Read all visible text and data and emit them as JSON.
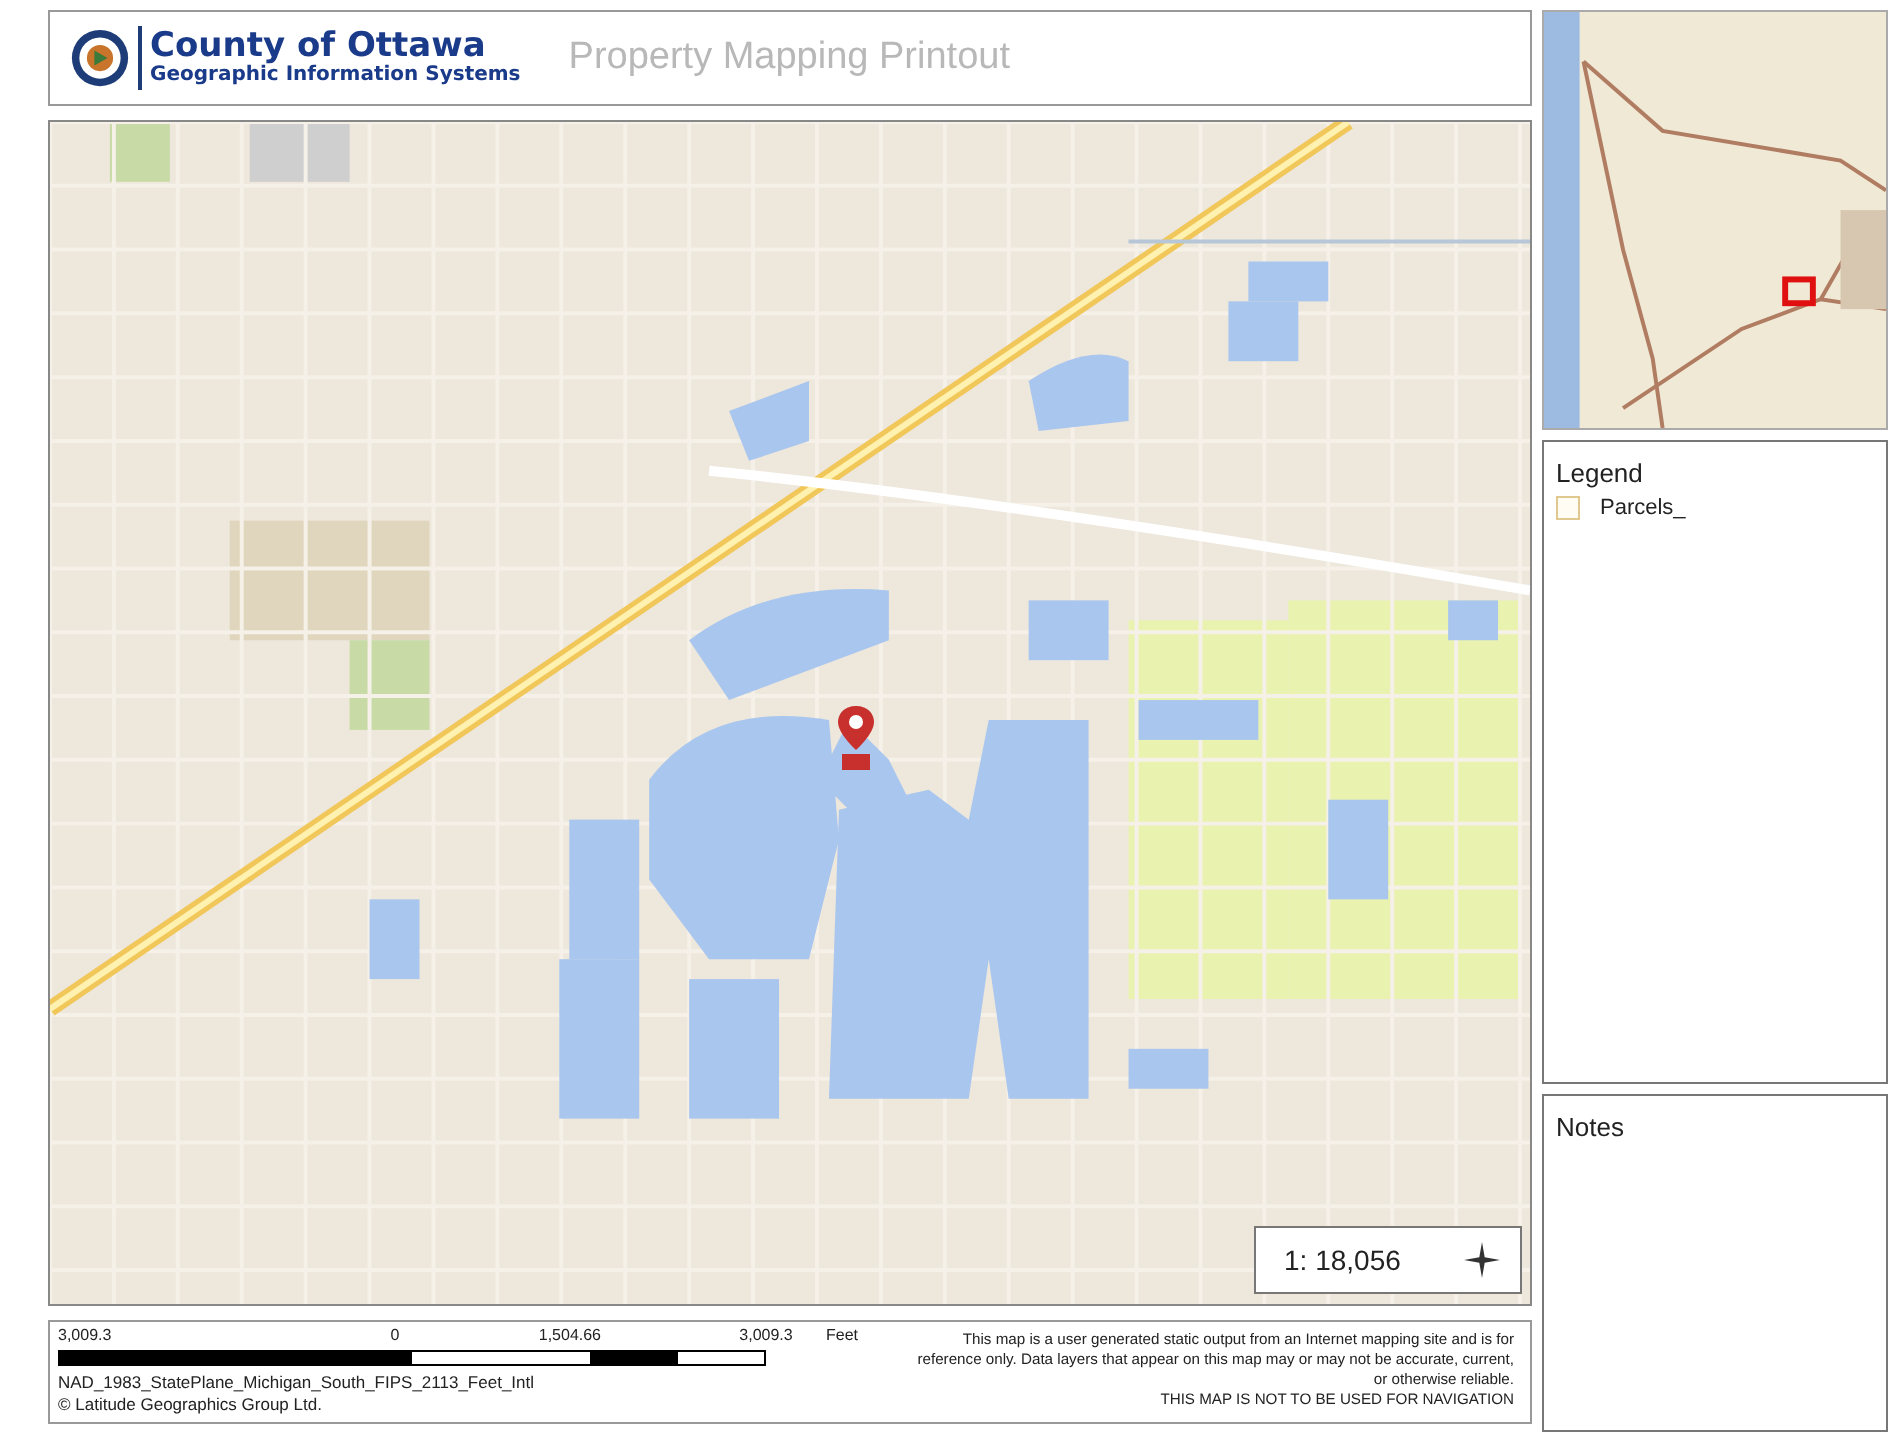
{
  "header": {
    "org_name": "County of Ottawa",
    "org_subtitle": "Geographic Information Systems",
    "title": "Property Mapping Printout"
  },
  "map": {
    "scale": "1: 18,056"
  },
  "scale_bar": {
    "labels": [
      "3,009.3",
      "0",
      "1,504.66",
      "3,009.3"
    ],
    "unit": "Feet"
  },
  "projection": "NAD_1983_StatePlane_Michigan_South_FIPS_2113_Feet_Intl",
  "copyright": "© Latitude Geographics Group Ltd.",
  "disclaimer": "This map is a user generated static output from an Internet mapping site and is for reference only. Data layers that appear on this map may or may not be accurate, current, or otherwise reliable.",
  "warning": "THIS MAP IS NOT TO BE USED FOR NAVIGATION",
  "legend": {
    "title": "Legend",
    "items": [
      {
        "label": "Parcels_"
      }
    ]
  },
  "notes": {
    "title": "Notes"
  }
}
